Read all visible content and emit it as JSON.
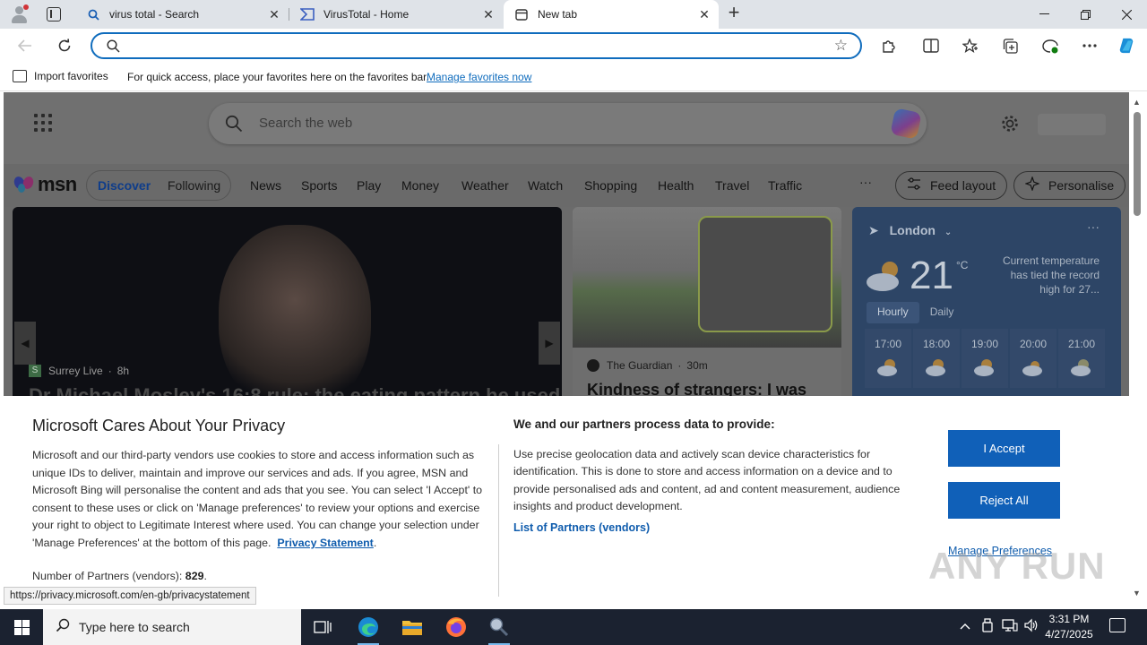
{
  "browser": {
    "tabs": [
      {
        "title": "virus total - Search",
        "icon": "search-icon"
      },
      {
        "title": "VirusTotal - Home",
        "icon": "virustotal-icon"
      },
      {
        "title": "New tab",
        "icon": "newtab-icon"
      }
    ],
    "address": {
      "value": "",
      "placeholder": ""
    },
    "favorites_bar": {
      "import_label": "Import favorites",
      "message": "For quick access, place your favorites here on the favorites bar.",
      "manage_link": "Manage favorites now"
    }
  },
  "newtab": {
    "search_placeholder": "Search the web",
    "msn_logo": "msn",
    "feed_tabs": [
      "Discover",
      "Following"
    ],
    "nav_items": [
      "News",
      "Sports",
      "Play",
      "Money",
      "Weather",
      "Watch",
      "Shopping",
      "Health",
      "Travel",
      "Traffic"
    ],
    "more": "···",
    "feed_layout": "Feed layout",
    "personalise": "Personalise",
    "hero": {
      "source": "Surrey Live",
      "age": "8h",
      "headline": "Dr Michael Mosley's 16:8 rule: the eating pattern he used"
    },
    "card2": {
      "source": "The Guardian",
      "age": "30m",
      "headline": "Kindness of strangers: I was"
    },
    "weather": {
      "location": "London",
      "temperature": "21",
      "unit": "°C",
      "note": "Current temperature has tied the record high for 27...",
      "modes": [
        "Hourly",
        "Daily"
      ],
      "hours": [
        "17:00",
        "18:00",
        "19:00",
        "20:00",
        "21:00"
      ]
    }
  },
  "privacy": {
    "title": "Microsoft Cares About Your Privacy",
    "body": "Microsoft and our third-party vendors use cookies to store and access information such as unique IDs to deliver, maintain and improve our services and ads. If you agree, MSN and Microsoft Bing will personalise the content and ads that you see. You can select 'I Accept' to consent to these uses or click on 'Manage preferences' to review your options and exercise your right to object to Legitimate Interest where used.  You can change your selection under 'Manage Preferences' at the bottom of this page.",
    "privacy_link": "Privacy Statement",
    "partners_label": "Number of Partners (vendors):",
    "partners_count": "829",
    "right_title": "We and our partners process data to provide:",
    "right_body": "Use precise geolocation data and actively scan device characteristics for identification. This is done to store and access information on a device and to provide personalised ads and content, ad and content measurement, audience insights and product development.",
    "list_partners": "List of Partners (vendors)",
    "accept": "I Accept",
    "reject": "Reject All",
    "manage": "Manage Preferences"
  },
  "status_url": "https://privacy.microsoft.com/en-gb/privacystatement",
  "watermark": "ANY RUN",
  "taskbar": {
    "search_placeholder": "Type here to search",
    "time": "3:31 PM",
    "date": "4/27/2025"
  },
  "colors": {
    "accent": "#0f6cbd",
    "button": "#1060b8",
    "taskbar": "#1b2230"
  }
}
